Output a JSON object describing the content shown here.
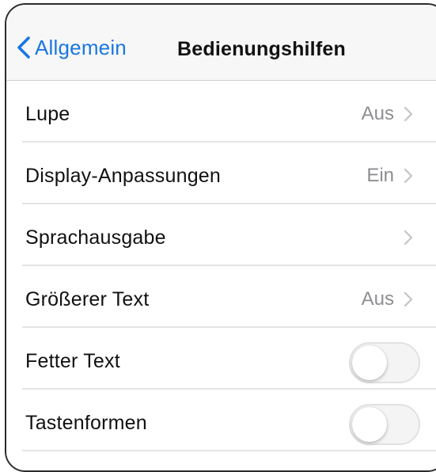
{
  "navbar": {
    "back_label": "Allgemein",
    "title": "Bedienungshilfen"
  },
  "colors": {
    "accent": "#1a76e3",
    "value_text": "#8e8e93",
    "toggle_off": "#f4f4f5"
  },
  "rows": [
    {
      "label": "Lupe",
      "value": "Aus",
      "type": "disclosure",
      "icon": "chevron-right-icon"
    },
    {
      "label": "Display-Anpassungen",
      "value": "Ein",
      "type": "disclosure",
      "icon": "chevron-right-icon"
    },
    {
      "label": "Sprachausgabe",
      "value": "",
      "type": "disclosure",
      "icon": "chevron-right-icon"
    },
    {
      "label": "Größerer Text",
      "value": "Aus",
      "type": "disclosure",
      "icon": "chevron-right-icon"
    },
    {
      "label": "Fetter Text",
      "type": "toggle",
      "on": false
    },
    {
      "label": "Tastenformen",
      "type": "toggle",
      "on": false
    }
  ]
}
